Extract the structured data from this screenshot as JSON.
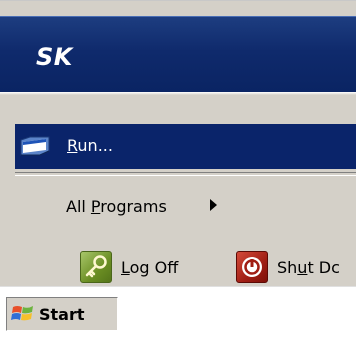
{
  "user": {
    "name": "SK"
  },
  "menu": {
    "run": {
      "label_accel": "R",
      "label_rest": "un..."
    },
    "all_programs": {
      "label_prefix": "All ",
      "label_accel": "P",
      "label_rest": "rograms"
    }
  },
  "footer": {
    "logoff": {
      "label_accel": "L",
      "label_rest": "og Off",
      "icon": "key-icon"
    },
    "shutdown": {
      "label_prefix": "Sh",
      "label_accel": "u",
      "label_rest": "t Dc",
      "icon": "power-icon"
    }
  },
  "taskbar": {
    "start_label": "Start",
    "start_icon": "windows-flag-icon"
  },
  "colors": {
    "header_blue": "#0a2463",
    "selection_blue": "#0a246a",
    "menu_gray": "#d4d0c8",
    "logoff_green": "#6b8e23",
    "shutdown_red": "#a01e14"
  }
}
